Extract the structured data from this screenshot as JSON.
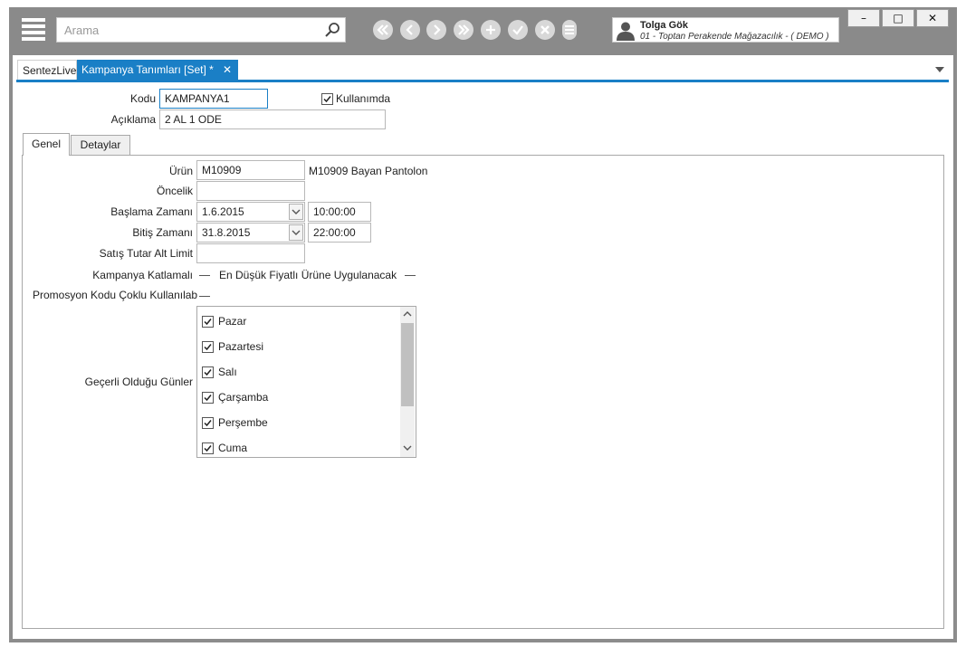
{
  "search": {
    "placeholder": "Arama"
  },
  "user": {
    "name": "Tolga Gök",
    "company": "01 - Toptan Perakende Mağazacılık - ( DEMO )"
  },
  "window_buttons": {
    "minimize": "–",
    "maximize": "□",
    "close": "✕"
  },
  "tabs": [
    {
      "label": "SentezLive"
    },
    {
      "label": "Kampanya Tanımları  [Set] *"
    }
  ],
  "tab_close": "✕",
  "form": {
    "kodu_label": "Kodu",
    "kodu_value": "KAMPANYA1",
    "kullanimda_label": "Kullanımda",
    "kullanimda_checked": true,
    "aciklama_label": "Açıklama",
    "aciklama_value": "2 AL 1 ODE"
  },
  "inner_tabs": [
    {
      "label": "Genel"
    },
    {
      "label": "Detaylar"
    }
  ],
  "genel": {
    "urun_label": "Ürün",
    "urun_value": "M10909",
    "urun_desc": "M10909 Bayan Pantolon",
    "oncelik_label": "Öncelik",
    "oncelik_value": "",
    "baslama_label": "Başlama Zamanı",
    "baslama_date": "1.6.2015",
    "baslama_time": "10:00:00",
    "bitis_label": "Bitiş Zamanı",
    "bitis_date": "31.8.2015",
    "bitis_time": "22:00:00",
    "satis_label": "Satış Tutar Alt Limit",
    "satis_value": "",
    "katlamali_label": "Kampanya Katlamalı",
    "en_dusuk_label": "En Düşük Fiyatlı Ürüne Uygulanacak",
    "promosyon_label": "Promosyon Kodu Çoklu Kullanılab",
    "gecerli_label": "Geçerli Olduğu Günler",
    "days": [
      {
        "label": "Pazar",
        "checked": true
      },
      {
        "label": "Pazartesi",
        "checked": true
      },
      {
        "label": "Salı",
        "checked": true
      },
      {
        "label": "Çarşamba",
        "checked": true
      },
      {
        "label": "Perşembe",
        "checked": true
      },
      {
        "label": "Cuma",
        "checked": true
      }
    ]
  },
  "colors": {
    "accent": "#1a7fc6",
    "titlebar": "#8a8a8a"
  }
}
